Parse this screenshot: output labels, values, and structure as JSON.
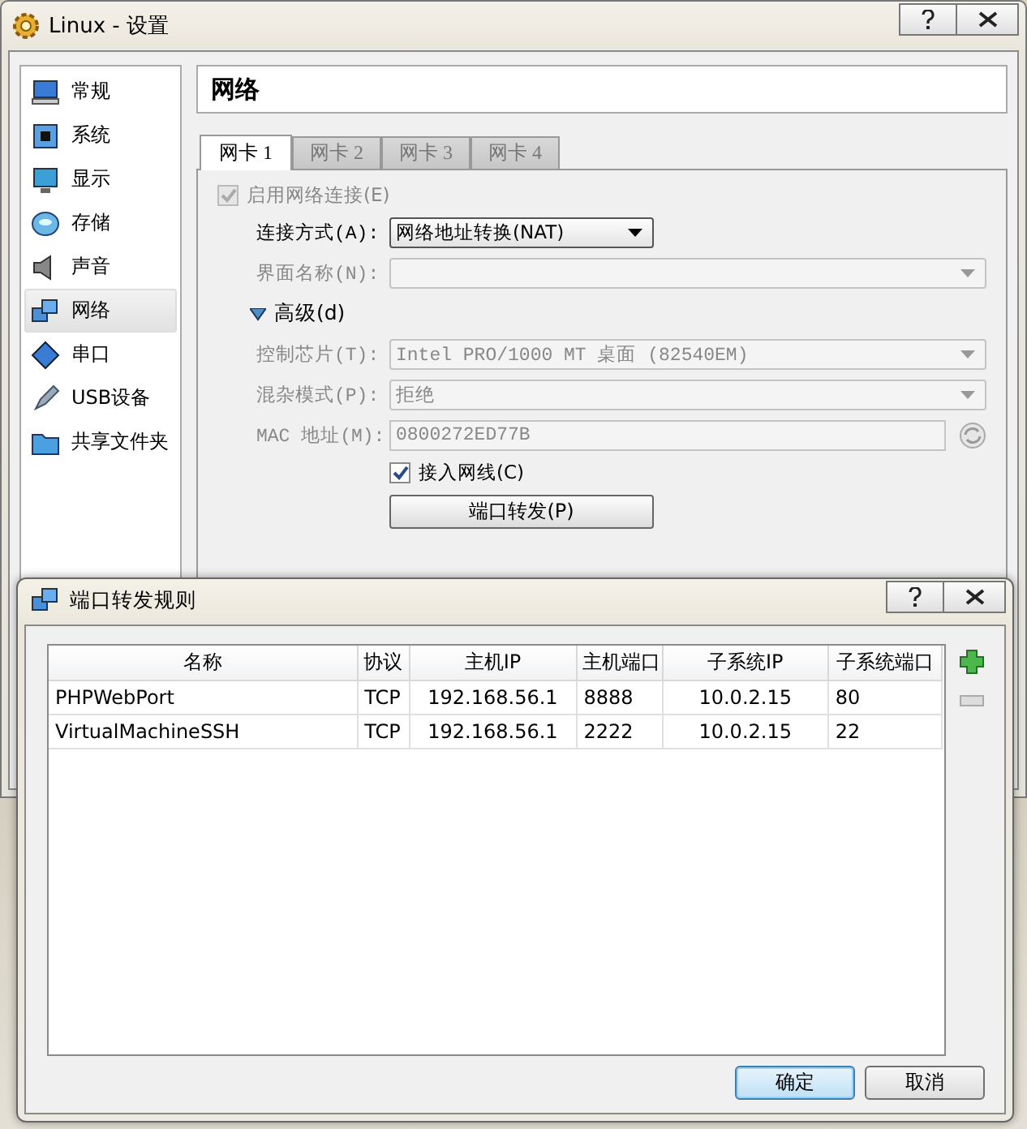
{
  "window": {
    "title": "Linux - 设置"
  },
  "sidebar": {
    "items": [
      {
        "label": "常规",
        "selected": false
      },
      {
        "label": "系统",
        "selected": false
      },
      {
        "label": "显示",
        "selected": false
      },
      {
        "label": "存储",
        "selected": false
      },
      {
        "label": "声音",
        "selected": false
      },
      {
        "label": "网络",
        "selected": true
      },
      {
        "label": "串口",
        "selected": false
      },
      {
        "label": "USB设备",
        "selected": false
      },
      {
        "label": "共享文件夹",
        "selected": false
      }
    ]
  },
  "page": {
    "title": "网络"
  },
  "tabs": [
    {
      "label": "网卡 1",
      "selected": true
    },
    {
      "label": "网卡 2",
      "selected": false
    },
    {
      "label": "网卡 3",
      "selected": false
    },
    {
      "label": "网卡 4",
      "selected": false
    }
  ],
  "settings": [
    {
      "kind": "checkbox",
      "label": "启用网络连接(E)",
      "checked": true,
      "disabled": true
    },
    {
      "kind": "dropdown",
      "label": "连接方式(A):",
      "value": "网络地址转换(NAT)",
      "disabled": false
    },
    {
      "kind": "dropdown",
      "label": "界面名称(N):",
      "disabled": true
    },
    {
      "kind": "expander",
      "label": "高级(d)",
      "expanded": true
    },
    {
      "kind": "dropdown",
      "label": "控制芯片(T):",
      "value": "Intel PRO/1000 MT 桌面 (82540EM)",
      "disabled": true
    },
    {
      "kind": "dropdown",
      "label": "混杂模式(P):",
      "value": "拒绝",
      "disabled": true
    },
    {
      "kind": "field",
      "label": "MAC 地址(M):",
      "value": "0800272ED77B",
      "disabled": true
    },
    {
      "kind": "option",
      "label": "接入网线(C)",
      "checked": true,
      "disabled": false
    },
    {
      "kind": "button",
      "label": "端口转发(P)"
    }
  ],
  "dialog": {
    "title": "端口转发规则",
    "columns": [
      "名称",
      "协议",
      "主机IP",
      "主机端口",
      "子系统IP",
      "子系统端口"
    ],
    "rows": [
      {
        "cells": [
          "PHPWebPort",
          "TCP",
          "192.168.56.1",
          "8888",
          "10.0.2.15",
          "80"
        ]
      },
      {
        "cells": [
          "VirtualMachineSSH",
          "TCP",
          "192.168.56.1",
          "2222",
          "10.0.2.15",
          "22"
        ]
      }
    ],
    "buttons": [
      {
        "label": "确定",
        "default": true
      },
      {
        "label": "取消",
        "default": false
      }
    ]
  }
}
